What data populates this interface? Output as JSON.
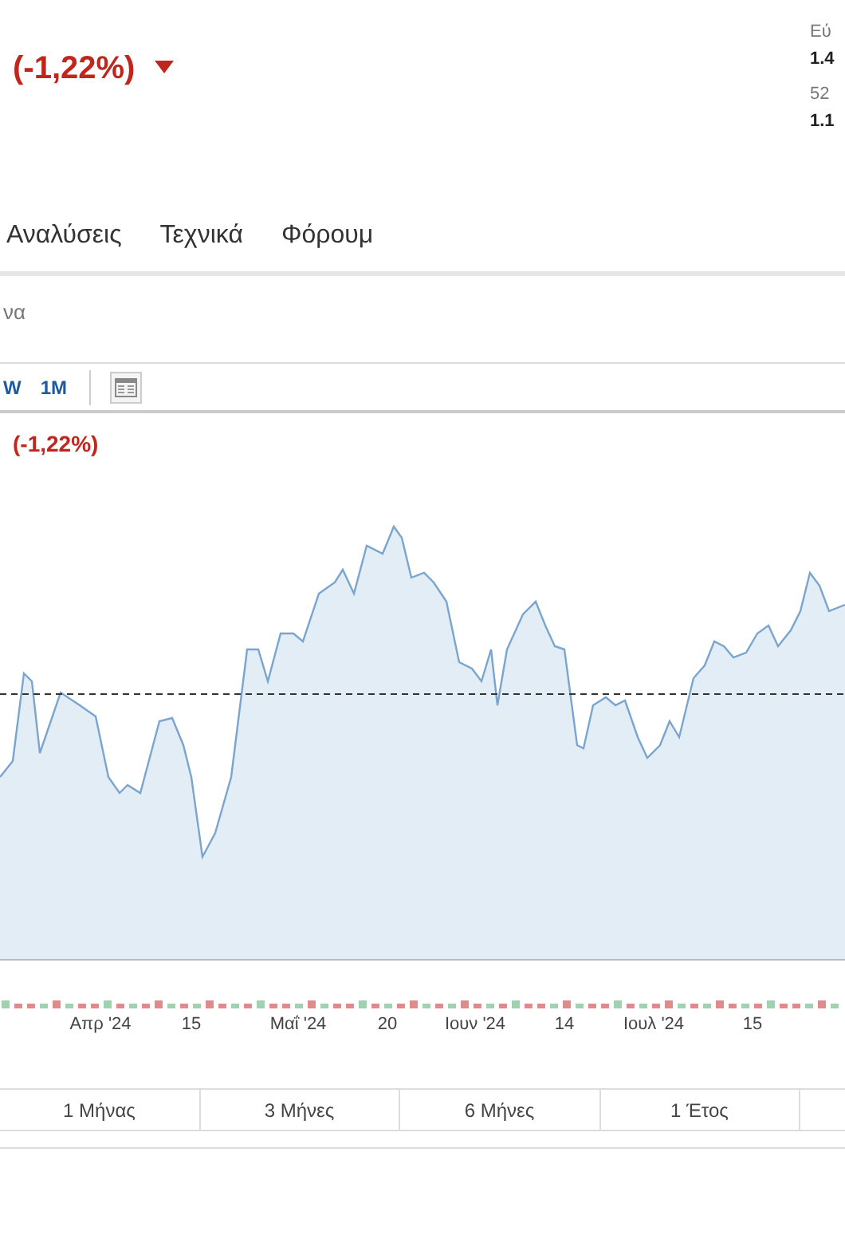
{
  "header": {
    "change": "(-1,22%)",
    "stats": [
      {
        "label": "Εύ",
        "value": "1.4"
      },
      {
        "label": "52",
        "value": "1.1"
      }
    ]
  },
  "tabs": [
    {
      "label": "Αναλύσεις"
    },
    {
      "label": "Τεχνικά"
    },
    {
      "label": "Φόρουμ"
    }
  ],
  "subheading": "να",
  "toolbar": {
    "intervals": [
      {
        "label": "W"
      },
      {
        "label": "1M"
      }
    ]
  },
  "chart": {
    "change": "(-1,22%)",
    "x_labels": [
      "Απρ '24",
      "15",
      "Μαΐ '24",
      "20",
      "Ιουν '24",
      "14",
      "Ιουλ '24",
      "15"
    ]
  },
  "periods": [
    {
      "label": "1 Μήνας"
    },
    {
      "label": "3 Μήνες"
    },
    {
      "label": "6 Μήνες"
    },
    {
      "label": "1 Έτος"
    }
  ]
}
